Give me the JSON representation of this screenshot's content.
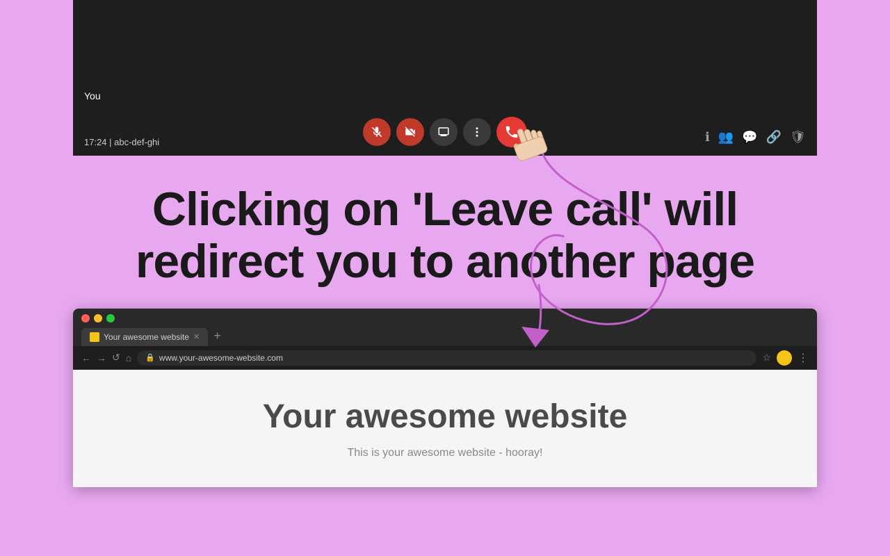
{
  "page": {
    "background_color": "#e8a8f0"
  },
  "video_bar": {
    "user_label": "You",
    "call_info": "17:24 | abc-def-ghi",
    "buttons": {
      "mute": "🎤",
      "camera_off": "📷",
      "share_screen": "📺",
      "more": "⋮",
      "leave_call": "📞"
    }
  },
  "instruction": {
    "text": "Clicking on 'Leave call' will redirect you to another page"
  },
  "browser": {
    "tab_label": "Your awesome website",
    "new_tab": "+",
    "address": "www.your-awesome-website.com",
    "website_title": "Your awesome website",
    "website_subtitle": "This is your awesome website - hooray!"
  }
}
